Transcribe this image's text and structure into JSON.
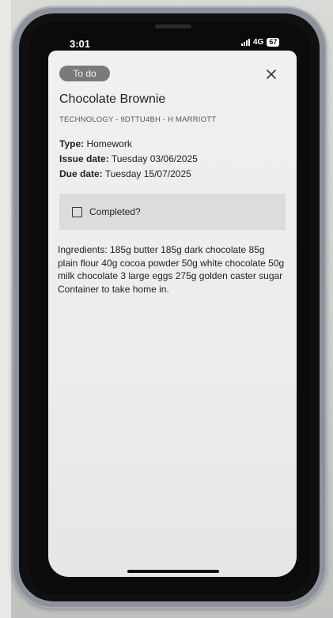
{
  "status_bar": {
    "time": "3:01",
    "network": "4G",
    "battery": "67"
  },
  "badge": {
    "label": "To do"
  },
  "close_icon": "close-icon",
  "task": {
    "title": "Chocolate Brownie",
    "subtitle": "TECHNOLOGY - 9DTTU4BH - H MARRIOTT",
    "type_label": "Type:",
    "type_value": "Homework",
    "issue_label": "Issue date:",
    "issue_value": "Tuesday 03/06/2025",
    "due_label": "Due date:",
    "due_value": "Tuesday 15/07/2025",
    "completed_label": "Completed?",
    "completed": false,
    "description": "Ingredients: 185g butter 185g dark chocolate 85g plain flour 40g cocoa powder 50g white chocolate 50g milk chocolate 3 large eggs 275g golden caster sugar Container to take home in."
  },
  "colors": {
    "badge_bg": "#7a7a7a",
    "sheet_bg": "#efefef",
    "completed_bg": "#dcdcdc",
    "phone_frame": "#8e929a"
  }
}
